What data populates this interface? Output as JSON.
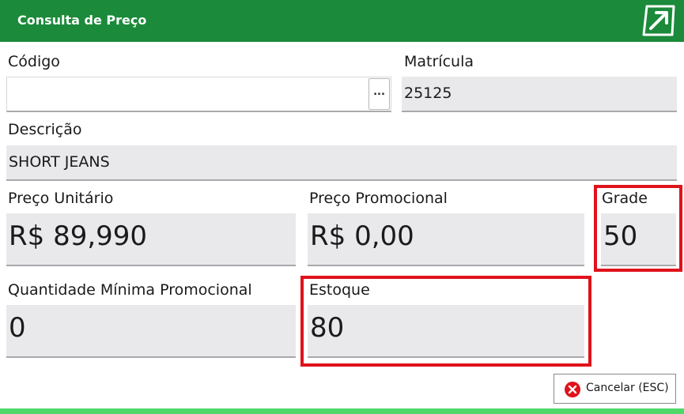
{
  "header": {
    "title": "Consulta de Preço",
    "icon": "external-open-icon",
    "background_color": "#1b8a3a"
  },
  "form": {
    "codigo": {
      "label": "Código",
      "value": "",
      "browse_label": "..."
    },
    "matricula": {
      "label": "Matrícula",
      "value": "25125"
    },
    "descricao": {
      "label": "Descrição",
      "value": "SHORT JEANS"
    },
    "preco_unitario": {
      "label": "Preço Unitário",
      "value": "R$ 89,990"
    },
    "preco_promocional": {
      "label": "Preço Promocional",
      "value": "R$ 0,00"
    },
    "grade": {
      "label": "Grade",
      "value": "50"
    },
    "quantidade_minima": {
      "label": "Quantidade Mínima Promocional",
      "value": "0"
    },
    "estoque": {
      "label": "Estoque",
      "value": "80"
    }
  },
  "actions": {
    "cancel_label": "Cancelar (ESC)",
    "cancel_icon": "close-circle-icon"
  },
  "colors": {
    "highlight": "#e0121b",
    "field_background": "#e9e9ec",
    "bottom_bar": "#4fd86a",
    "cancel_icon": "#e0121b"
  }
}
